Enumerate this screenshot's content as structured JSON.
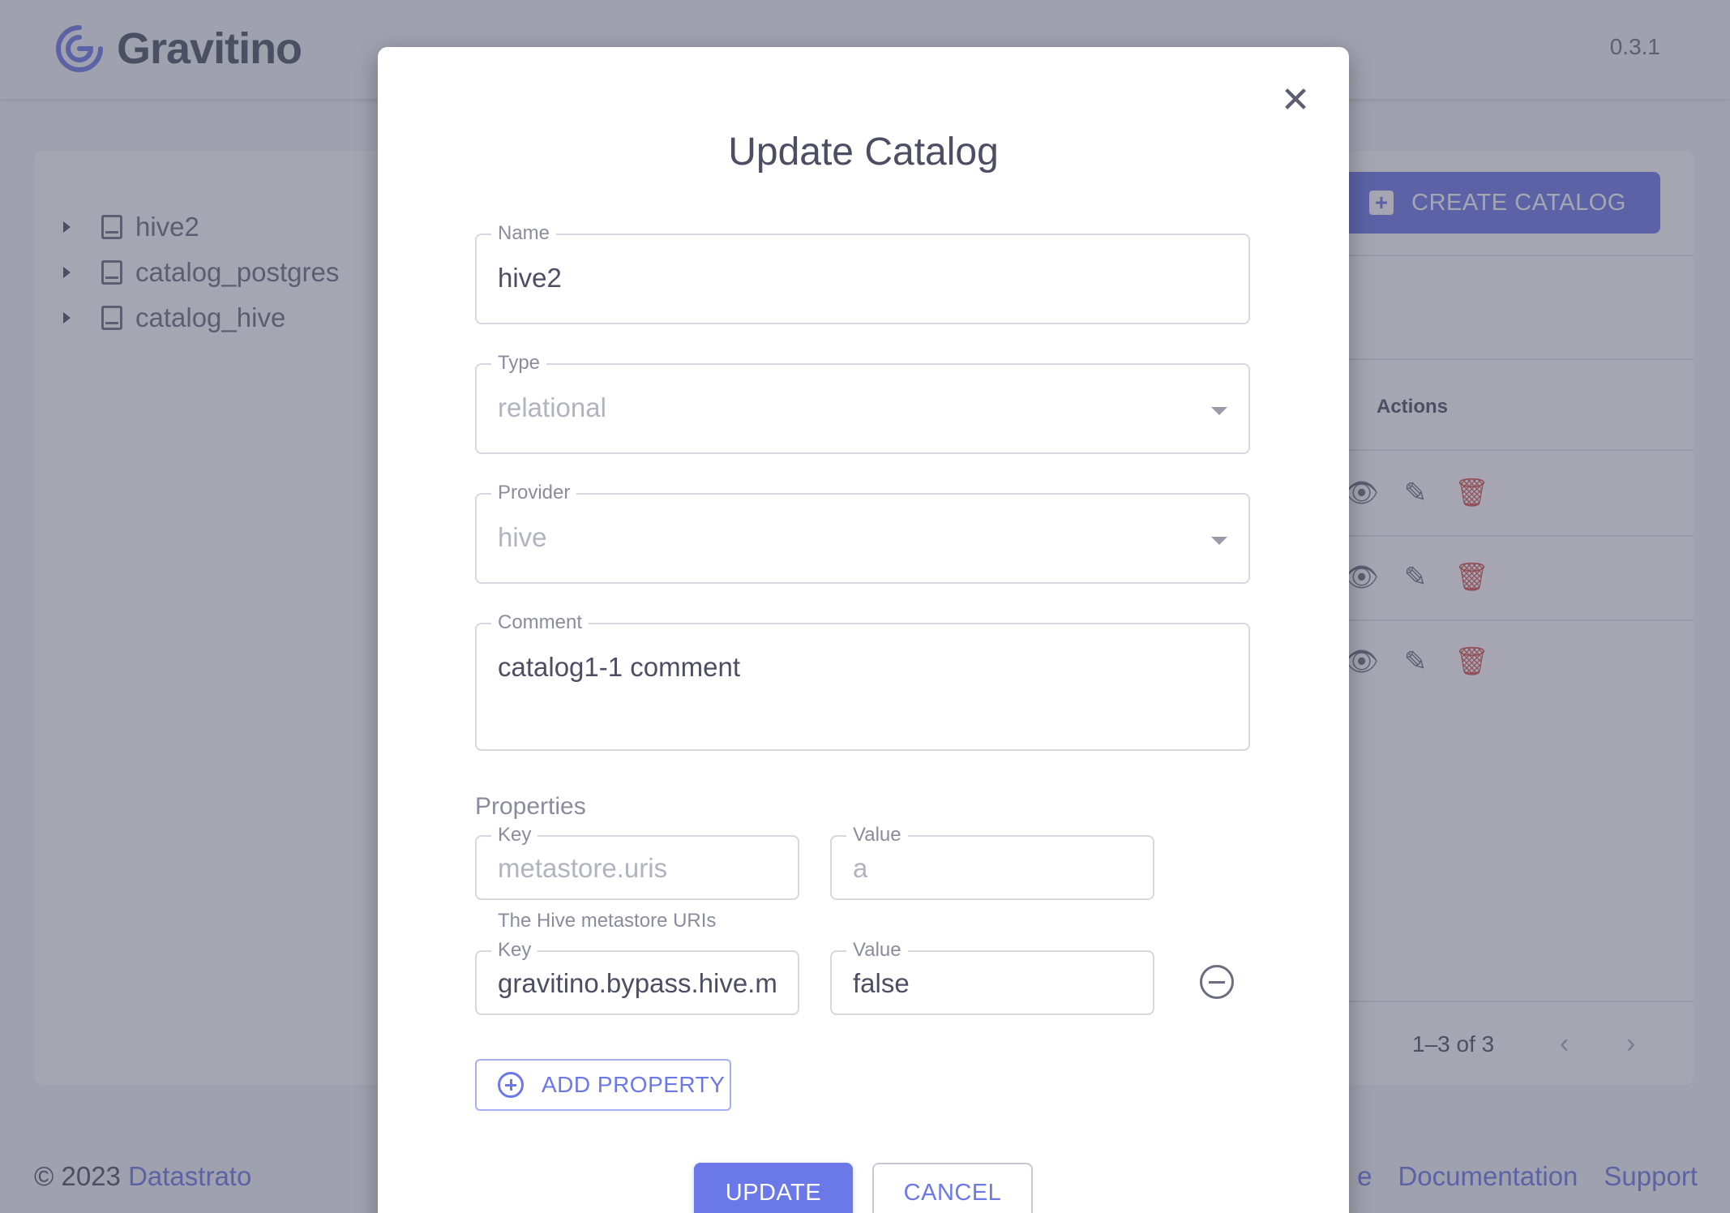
{
  "app": {
    "brand": "Gravitino",
    "version": "0.3.1"
  },
  "sidebar": {
    "items": [
      {
        "label": "hive2"
      },
      {
        "label": "catalog_postgres"
      },
      {
        "label": "catalog_hive"
      }
    ]
  },
  "main": {
    "create_button": "CREATE CATALOG",
    "actions_header": "Actions",
    "pagination": "1–3 of 3"
  },
  "footer": {
    "copyright": "© 2023 ",
    "company": "Datastrato",
    "links": {
      "partial": "e",
      "documentation": "Documentation",
      "support": "Support"
    }
  },
  "modal": {
    "title": "Update Catalog",
    "name": {
      "label": "Name",
      "value": "hive2"
    },
    "type": {
      "label": "Type",
      "value": "relational"
    },
    "provider": {
      "label": "Provider",
      "value": "hive"
    },
    "comment": {
      "label": "Comment",
      "value": "catalog1-1 comment"
    },
    "properties_label": "Properties",
    "properties": [
      {
        "key_label": "Key",
        "key": "metastore.uris",
        "value_label": "Value",
        "value": "a",
        "helper": "The Hive metastore URIs"
      },
      {
        "key_label": "Key",
        "key": "gravitino.bypass.hive.m",
        "value_label": "Value",
        "value": "false"
      }
    ],
    "add_property": "ADD PROPERTY",
    "update_button": "UPDATE",
    "cancel_button": "CANCEL"
  },
  "colors": {
    "primary": "#6b78e8",
    "danger": "#d9534f"
  }
}
